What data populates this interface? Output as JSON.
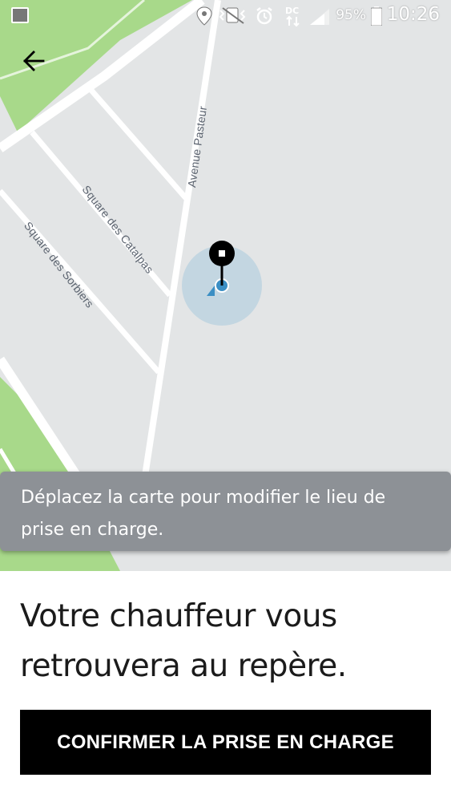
{
  "status_bar": {
    "battery": "95%",
    "time": "10:26",
    "icons": [
      "gallery-icon",
      "location-icon",
      "vibrate-icon",
      "alarm-icon",
      "data-icon",
      "signal-icon",
      "battery-icon"
    ]
  },
  "map": {
    "streets": [
      "Avenue Pasteur",
      "Square des Catalpas",
      "Square des Sorbiers"
    ],
    "colors": {
      "background": "#e3e5e6",
      "park": "#a8d98a",
      "road": "#ffffff",
      "accuracy": "#bdd3df",
      "location": "#3b8fc4"
    }
  },
  "toast": {
    "line1": "Déplacez la carte pour modifier le lieu de",
    "line2": "prise en charge."
  },
  "sheet": {
    "line1": "Votre chauffeur vous",
    "line2": "retrouvera au repère.",
    "confirm_label": "CONFIRMER LA PRISE EN CHARGE"
  }
}
